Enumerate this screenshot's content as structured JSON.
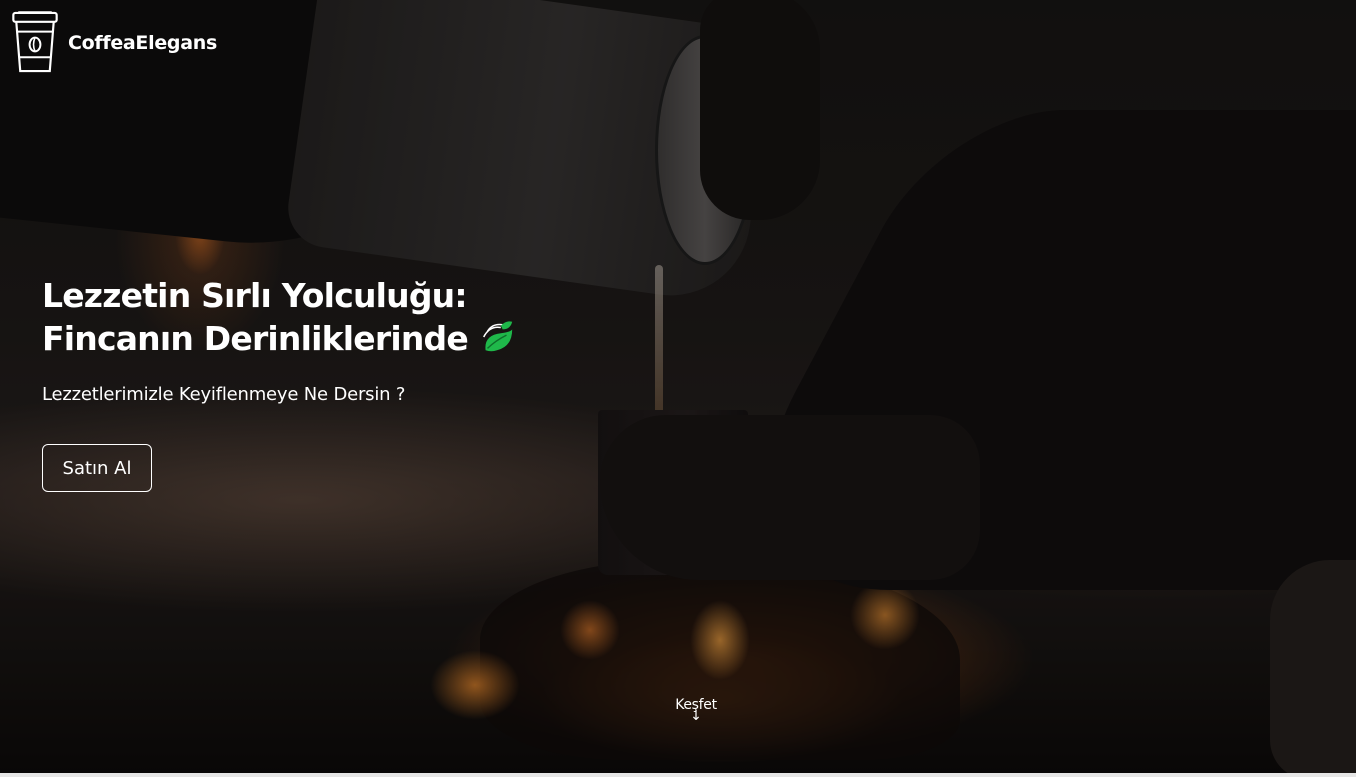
{
  "brand": {
    "name": "CoffeaElegans",
    "icon": "coffee-cup-icon"
  },
  "hero": {
    "headline_line1": "Lezzetin Sırlı Yolculuğu:",
    "headline_line2": "Fincanın Derinliklerinde",
    "headline_icon": "green-leaf-icon",
    "subtitle": "Lezzetlerimizle Keyiflenmeye Ne Dersin ?",
    "buy_button_label": "Satın Al",
    "explore_label": "Keşfet",
    "explore_arrow": "↓"
  },
  "colors": {
    "text": "#ffffff",
    "leaf": "#1fb84a",
    "background": "#1c1816",
    "fire": "#ff8c32"
  }
}
